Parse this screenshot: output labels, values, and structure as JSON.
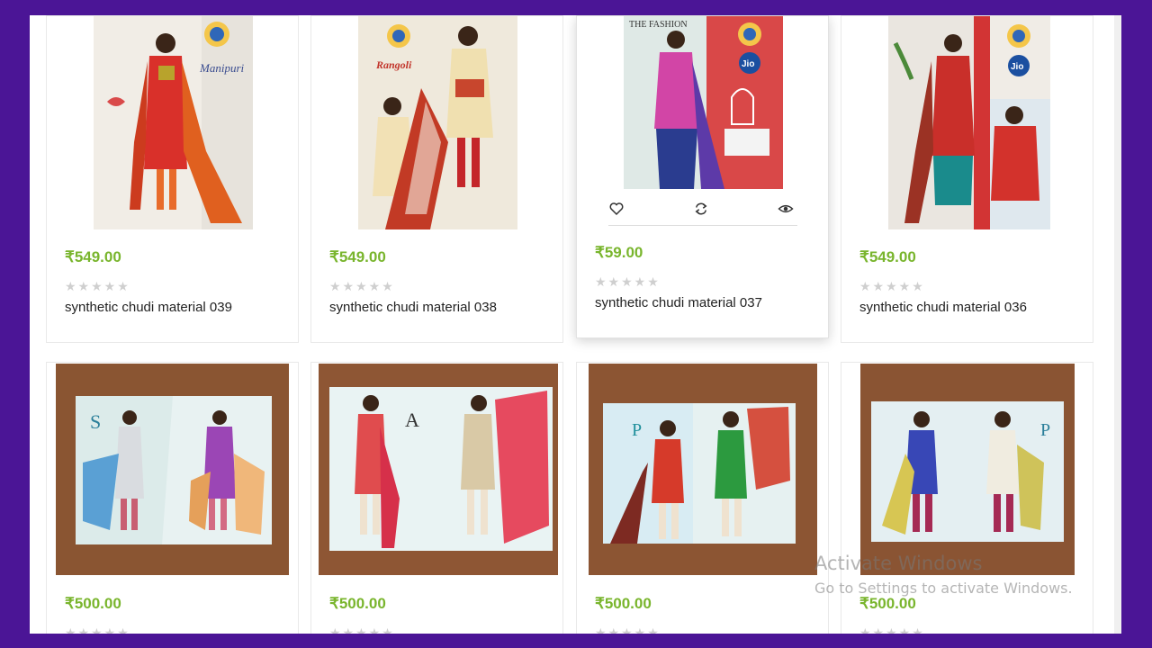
{
  "currency_color": "#79b52d",
  "frame_color": "#4b1596",
  "products": [
    {
      "price": "₹549.00",
      "title": "synthetic chudi material 039",
      "rating_stars": "★★★★★",
      "rating": 0,
      "brand_label": "Manipuri"
    },
    {
      "price": "₹549.00",
      "title": "synthetic chudi material 038",
      "rating_stars": "★★★★★",
      "rating": 0,
      "brand_label": "Rangoli"
    },
    {
      "price": "₹59.00",
      "title": "synthetic chudi material 037",
      "rating_stars": "★★★★★",
      "rating": 0,
      "brand_label": "THE FASHION",
      "badge": "Jio"
    },
    {
      "price": "₹549.00",
      "title": "synthetic chudi material 036",
      "rating_stars": "★★★★★",
      "rating": 0,
      "badge": "Jio"
    },
    {
      "price": "₹500.00",
      "title": "",
      "rating_stars": "★★★★★",
      "rating": 0,
      "catalog_letter": "S"
    },
    {
      "price": "₹500.00",
      "title": "",
      "rating_stars": "★★★★★",
      "rating": 0,
      "catalog_letter": "A"
    },
    {
      "price": "₹500.00",
      "title": "",
      "rating_stars": "★★★★★",
      "rating": 0,
      "catalog_letter": "P"
    },
    {
      "price": "₹500.00",
      "title": "",
      "rating_stars": "★★★★★",
      "rating": 0,
      "catalog_letter": "P"
    }
  ],
  "hover_actions": {
    "wishlist_icon": "heart-icon",
    "compare_icon": "refresh-icon",
    "quickview_icon": "eye-icon"
  },
  "watermark": {
    "title": "Activate Windows",
    "subtitle": "Go to Settings to activate Windows."
  }
}
